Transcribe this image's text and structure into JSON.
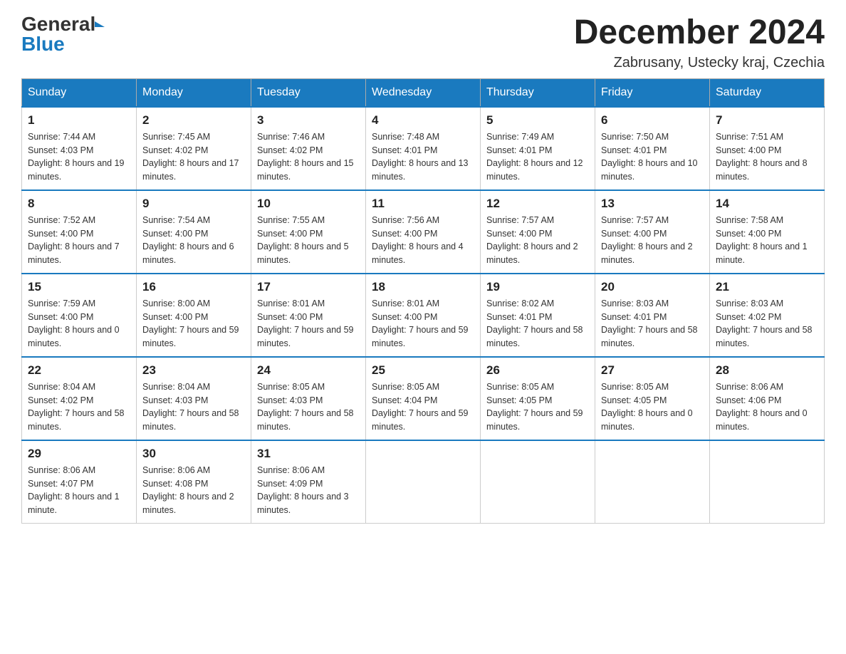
{
  "header": {
    "logo_general": "General",
    "logo_blue": "Blue",
    "month_title": "December 2024",
    "subtitle": "Zabrusany, Ustecky kraj, Czechia"
  },
  "days_of_week": [
    "Sunday",
    "Monday",
    "Tuesday",
    "Wednesday",
    "Thursday",
    "Friday",
    "Saturday"
  ],
  "weeks": [
    [
      {
        "day": "1",
        "sunrise": "7:44 AM",
        "sunset": "4:03 PM",
        "daylight": "8 hours and 19 minutes."
      },
      {
        "day": "2",
        "sunrise": "7:45 AM",
        "sunset": "4:02 PM",
        "daylight": "8 hours and 17 minutes."
      },
      {
        "day": "3",
        "sunrise": "7:46 AM",
        "sunset": "4:02 PM",
        "daylight": "8 hours and 15 minutes."
      },
      {
        "day": "4",
        "sunrise": "7:48 AM",
        "sunset": "4:01 PM",
        "daylight": "8 hours and 13 minutes."
      },
      {
        "day": "5",
        "sunrise": "7:49 AM",
        "sunset": "4:01 PM",
        "daylight": "8 hours and 12 minutes."
      },
      {
        "day": "6",
        "sunrise": "7:50 AM",
        "sunset": "4:01 PM",
        "daylight": "8 hours and 10 minutes."
      },
      {
        "day": "7",
        "sunrise": "7:51 AM",
        "sunset": "4:00 PM",
        "daylight": "8 hours and 8 minutes."
      }
    ],
    [
      {
        "day": "8",
        "sunrise": "7:52 AM",
        "sunset": "4:00 PM",
        "daylight": "8 hours and 7 minutes."
      },
      {
        "day": "9",
        "sunrise": "7:54 AM",
        "sunset": "4:00 PM",
        "daylight": "8 hours and 6 minutes."
      },
      {
        "day": "10",
        "sunrise": "7:55 AM",
        "sunset": "4:00 PM",
        "daylight": "8 hours and 5 minutes."
      },
      {
        "day": "11",
        "sunrise": "7:56 AM",
        "sunset": "4:00 PM",
        "daylight": "8 hours and 4 minutes."
      },
      {
        "day": "12",
        "sunrise": "7:57 AM",
        "sunset": "4:00 PM",
        "daylight": "8 hours and 2 minutes."
      },
      {
        "day": "13",
        "sunrise": "7:57 AM",
        "sunset": "4:00 PM",
        "daylight": "8 hours and 2 minutes."
      },
      {
        "day": "14",
        "sunrise": "7:58 AM",
        "sunset": "4:00 PM",
        "daylight": "8 hours and 1 minute."
      }
    ],
    [
      {
        "day": "15",
        "sunrise": "7:59 AM",
        "sunset": "4:00 PM",
        "daylight": "8 hours and 0 minutes."
      },
      {
        "day": "16",
        "sunrise": "8:00 AM",
        "sunset": "4:00 PM",
        "daylight": "7 hours and 59 minutes."
      },
      {
        "day": "17",
        "sunrise": "8:01 AM",
        "sunset": "4:00 PM",
        "daylight": "7 hours and 59 minutes."
      },
      {
        "day": "18",
        "sunrise": "8:01 AM",
        "sunset": "4:00 PM",
        "daylight": "7 hours and 59 minutes."
      },
      {
        "day": "19",
        "sunrise": "8:02 AM",
        "sunset": "4:01 PM",
        "daylight": "7 hours and 58 minutes."
      },
      {
        "day": "20",
        "sunrise": "8:03 AM",
        "sunset": "4:01 PM",
        "daylight": "7 hours and 58 minutes."
      },
      {
        "day": "21",
        "sunrise": "8:03 AM",
        "sunset": "4:02 PM",
        "daylight": "7 hours and 58 minutes."
      }
    ],
    [
      {
        "day": "22",
        "sunrise": "8:04 AM",
        "sunset": "4:02 PM",
        "daylight": "7 hours and 58 minutes."
      },
      {
        "day": "23",
        "sunrise": "8:04 AM",
        "sunset": "4:03 PM",
        "daylight": "7 hours and 58 minutes."
      },
      {
        "day": "24",
        "sunrise": "8:05 AM",
        "sunset": "4:03 PM",
        "daylight": "7 hours and 58 minutes."
      },
      {
        "day": "25",
        "sunrise": "8:05 AM",
        "sunset": "4:04 PM",
        "daylight": "7 hours and 59 minutes."
      },
      {
        "day": "26",
        "sunrise": "8:05 AM",
        "sunset": "4:05 PM",
        "daylight": "7 hours and 59 minutes."
      },
      {
        "day": "27",
        "sunrise": "8:05 AM",
        "sunset": "4:05 PM",
        "daylight": "8 hours and 0 minutes."
      },
      {
        "day": "28",
        "sunrise": "8:06 AM",
        "sunset": "4:06 PM",
        "daylight": "8 hours and 0 minutes."
      }
    ],
    [
      {
        "day": "29",
        "sunrise": "8:06 AM",
        "sunset": "4:07 PM",
        "daylight": "8 hours and 1 minute."
      },
      {
        "day": "30",
        "sunrise": "8:06 AM",
        "sunset": "4:08 PM",
        "daylight": "8 hours and 2 minutes."
      },
      {
        "day": "31",
        "sunrise": "8:06 AM",
        "sunset": "4:09 PM",
        "daylight": "8 hours and 3 minutes."
      },
      null,
      null,
      null,
      null
    ]
  ]
}
